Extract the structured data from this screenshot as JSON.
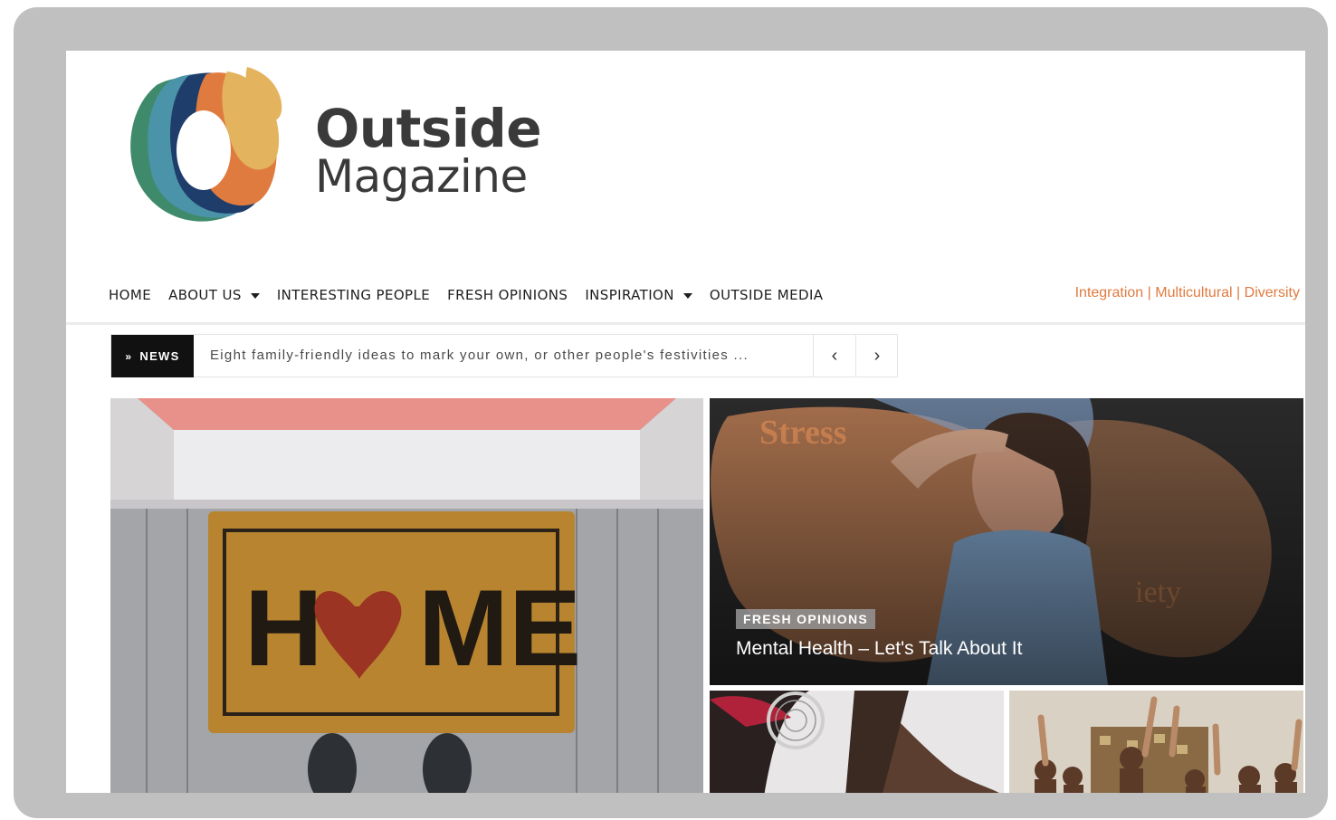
{
  "brand": {
    "line1": "Outside",
    "line2": "Magazine",
    "logo_icon": "wave-o-logo-icon",
    "colors": {
      "orange": "#e07b3f",
      "navy": "#1f3d6b",
      "teal": "#4a93a8",
      "green": "#3f8a6b",
      "sand": "#e3b35d"
    }
  },
  "nav": {
    "items": [
      {
        "label": "HOME",
        "dropdown": false
      },
      {
        "label": "ABOUT US",
        "dropdown": true
      },
      {
        "label": "INTERESTING PEOPLE",
        "dropdown": false
      },
      {
        "label": "FRESH OPINIONS",
        "dropdown": false
      },
      {
        "label": "INSPIRATION",
        "dropdown": true
      },
      {
        "label": "OUTSIDE MEDIA",
        "dropdown": false
      }
    ],
    "tagline": "Integration | Multicultural | Diversity"
  },
  "ticker": {
    "label": "NEWS",
    "label_icon": "double-chevron-right-icon",
    "headline": "Eight family-friendly ideas to mark your own, or other people's festivities ...",
    "prev_icon": "chevron-left-icon",
    "next_icon": "chevron-right-icon"
  },
  "featured": {
    "category": "FRESH OPINIONS",
    "title": "Mental Health – Let's Talk About It"
  },
  "images": {
    "big": "home-doormat-image",
    "featured": "stress-woman-image",
    "small1": "dreamcatcher-person-image",
    "small2": "celebrating-people-image"
  }
}
